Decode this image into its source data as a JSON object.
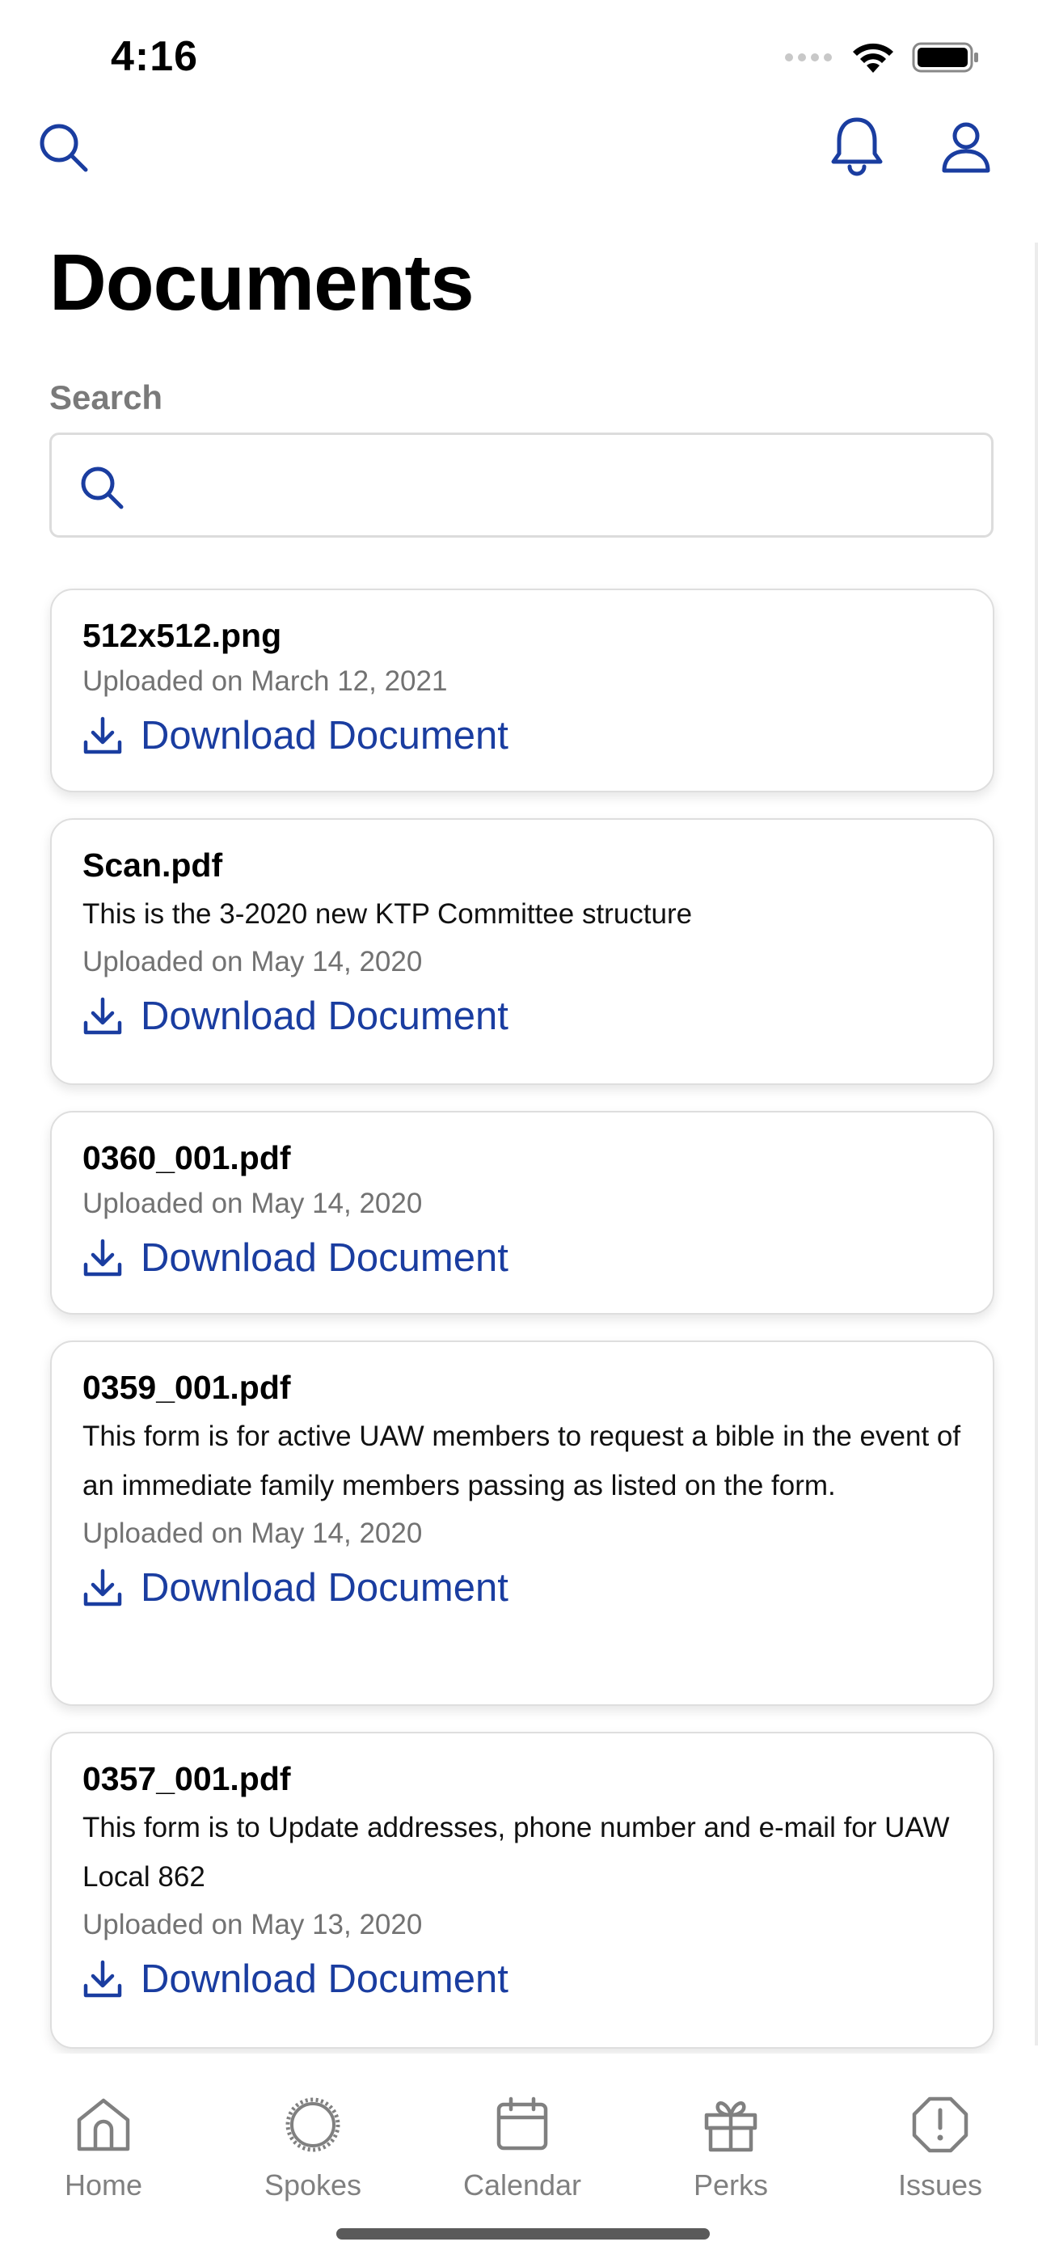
{
  "status_bar": {
    "time": "4:16",
    "icons": [
      "signal-dots-icon",
      "wifi-icon",
      "battery-icon"
    ]
  },
  "topnav": {
    "icons": [
      "search-icon",
      "bell-icon",
      "user-icon"
    ]
  },
  "page": {
    "title": "Documents"
  },
  "search": {
    "label": "Search",
    "value": "",
    "placeholder": ""
  },
  "documents": [
    {
      "title": "512x512.png",
      "description": "",
      "uploaded": "Uploaded on March 12, 2021",
      "download_label": "Download Document"
    },
    {
      "title": "Scan.pdf",
      "description": "This is the 3-2020 new KTP Committee structure",
      "uploaded": "Uploaded on May 14, 2020",
      "download_label": "Download Document"
    },
    {
      "title": "0360_001.pdf",
      "description": "",
      "uploaded": "Uploaded on May 14, 2020",
      "download_label": "Download Document"
    },
    {
      "title": "0359_001.pdf",
      "description": "This form is for active UAW members to request a bible in the event of an immediate family members passing as listed on the form.",
      "uploaded": "Uploaded on May 14, 2020",
      "download_label": "Download Document"
    },
    {
      "title": "0357_001.pdf",
      "description": "This form is to Update addresses, phone number and e-mail for UAW Local 862",
      "uploaded": "Uploaded on May 13, 2020",
      "download_label": "Download Document"
    }
  ],
  "tabbar": {
    "tabs": [
      {
        "label": "Home",
        "icon": "home-icon"
      },
      {
        "label": "Spokes",
        "icon": "spokes-icon"
      },
      {
        "label": "Calendar",
        "icon": "calendar-icon"
      },
      {
        "label": "Perks",
        "icon": "gift-icon"
      },
      {
        "label": "Issues",
        "icon": "alert-octagon-icon"
      }
    ]
  },
  "colors": {
    "accent": "#1a3da0",
    "text": "#000000",
    "muted": "#727272",
    "tab_inactive": "#808080",
    "border": "#dedede"
  }
}
